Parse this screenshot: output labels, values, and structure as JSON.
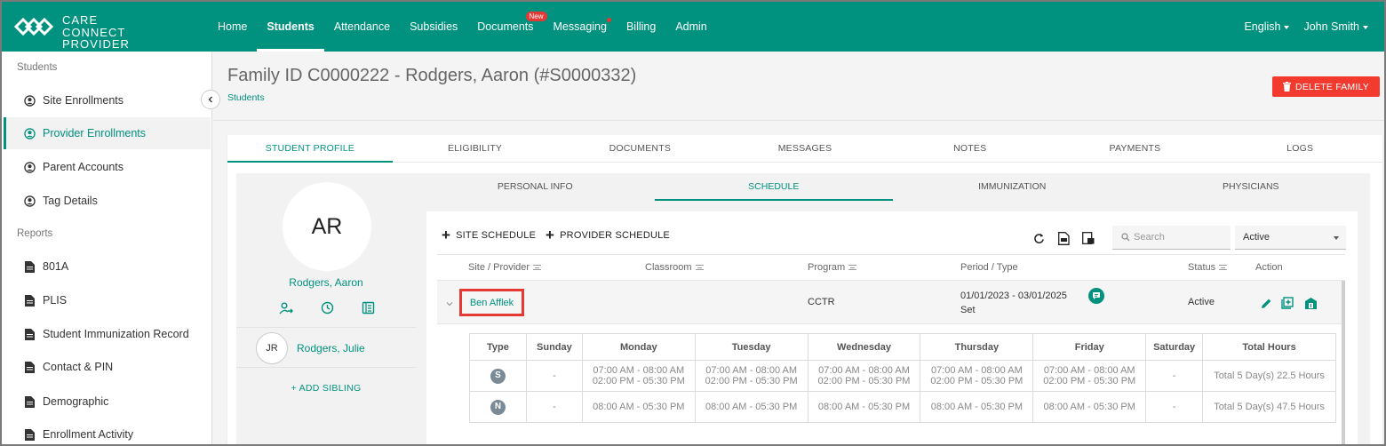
{
  "app": {
    "logo_line1": "CARE",
    "logo_line2": "CONNECT PROVIDER",
    "brand_color": "#00927e",
    "danger_color": "#f23a2e"
  },
  "nav": {
    "items": [
      {
        "label": "Home"
      },
      {
        "label": "Students",
        "active": true
      },
      {
        "label": "Attendance"
      },
      {
        "label": "Subsidies"
      },
      {
        "label": "Documents",
        "badge": "New"
      },
      {
        "label": "Messaging",
        "dot": true
      },
      {
        "label": "Billing"
      },
      {
        "label": "Admin"
      }
    ],
    "language": "English",
    "user": "John Smith"
  },
  "sidebar": {
    "section_students": "Students",
    "students_items": [
      {
        "label": "Site Enrollments",
        "icon": "person-circle-icon"
      },
      {
        "label": "Provider Enrollments",
        "icon": "person-circle-icon",
        "active": true
      },
      {
        "label": "Parent Accounts",
        "icon": "person-circle-icon"
      },
      {
        "label": "Tag Details",
        "icon": "person-circle-icon"
      }
    ],
    "section_reports": "Reports",
    "reports_items": [
      {
        "label": "801A",
        "icon": "document-icon"
      },
      {
        "label": "PLIS",
        "icon": "document-icon"
      },
      {
        "label": "Student Immunization Record",
        "icon": "document-icon"
      },
      {
        "label": "Contact & PIN",
        "icon": "document-icon"
      },
      {
        "label": "Demographic",
        "icon": "document-icon"
      },
      {
        "label": "Enrollment Activity",
        "icon": "document-icon"
      }
    ]
  },
  "header": {
    "title": "Family ID C0000222 - Rodgers, Aaron (#S0000332)",
    "breadcrumb": "Students",
    "delete_button": "DELETE FAMILY"
  },
  "tabs_main": [
    "STUDENT PROFILE",
    "ELIGIBILITY",
    "DOCUMENTS",
    "MESSAGES",
    "NOTES",
    "PAYMENTS",
    "LOGS"
  ],
  "profile": {
    "initials": "AR",
    "name": "Rodgers, Aaron",
    "sibling_initials": "JR",
    "sibling_name": "Rodgers, Julie",
    "add_sibling": "+ ADD SIBLING"
  },
  "tabs_sub": [
    "PERSONAL INFO",
    "SCHEDULE",
    "IMMUNIZATION",
    "PHYSICIANS"
  ],
  "schedule": {
    "site_schedule_label": "SITE SCHEDULE",
    "provider_schedule_label": "PROVIDER SCHEDULE",
    "search_placeholder": "Search",
    "status_filter": "Active",
    "columns": {
      "site_provider": "Site / Provider",
      "classroom": "Classroom",
      "program": "Program",
      "period_type": "Period / Type",
      "status": "Status",
      "action": "Action"
    },
    "row": {
      "provider": "Ben Afflek",
      "program": "CCTR",
      "period": "01/01/2023 - 03/01/2025",
      "type": "Set",
      "status": "Active"
    },
    "detail_headers": [
      "Type",
      "Sunday",
      "Monday",
      "Tuesday",
      "Wednesday",
      "Thursday",
      "Friday",
      "Saturday",
      "Total Hours"
    ],
    "detail_rows": [
      {
        "type": "S",
        "sunday": "-",
        "monday": [
          "07:00 AM - 08:00 AM",
          "02:00 PM - 05:30 PM"
        ],
        "tuesday": [
          "07:00 AM - 08:00 AM",
          "02:00 PM - 05:30 PM"
        ],
        "wednesday": [
          "07:00 AM - 08:00 AM",
          "02:00 PM - 05:30 PM"
        ],
        "thursday": [
          "07:00 AM - 08:00 AM",
          "02:00 PM - 05:30 PM"
        ],
        "friday": [
          "07:00 AM - 08:00 AM",
          "02:00 PM - 05:30 PM"
        ],
        "saturday": "-",
        "total": "Total 5 Day(s) 22.5 Hours"
      },
      {
        "type": "N",
        "sunday": "-",
        "monday": [
          "08:00 AM - 05:30 PM"
        ],
        "tuesday": [
          "08:00 AM - 05:30 PM"
        ],
        "wednesday": [
          "08:00 AM - 05:30 PM"
        ],
        "thursday": [
          "08:00 AM - 05:30 PM"
        ],
        "friday": [
          "08:00 AM - 05:30 PM"
        ],
        "saturday": "-",
        "total": "Total 5 Day(s) 47.5 Hours"
      }
    ]
  }
}
